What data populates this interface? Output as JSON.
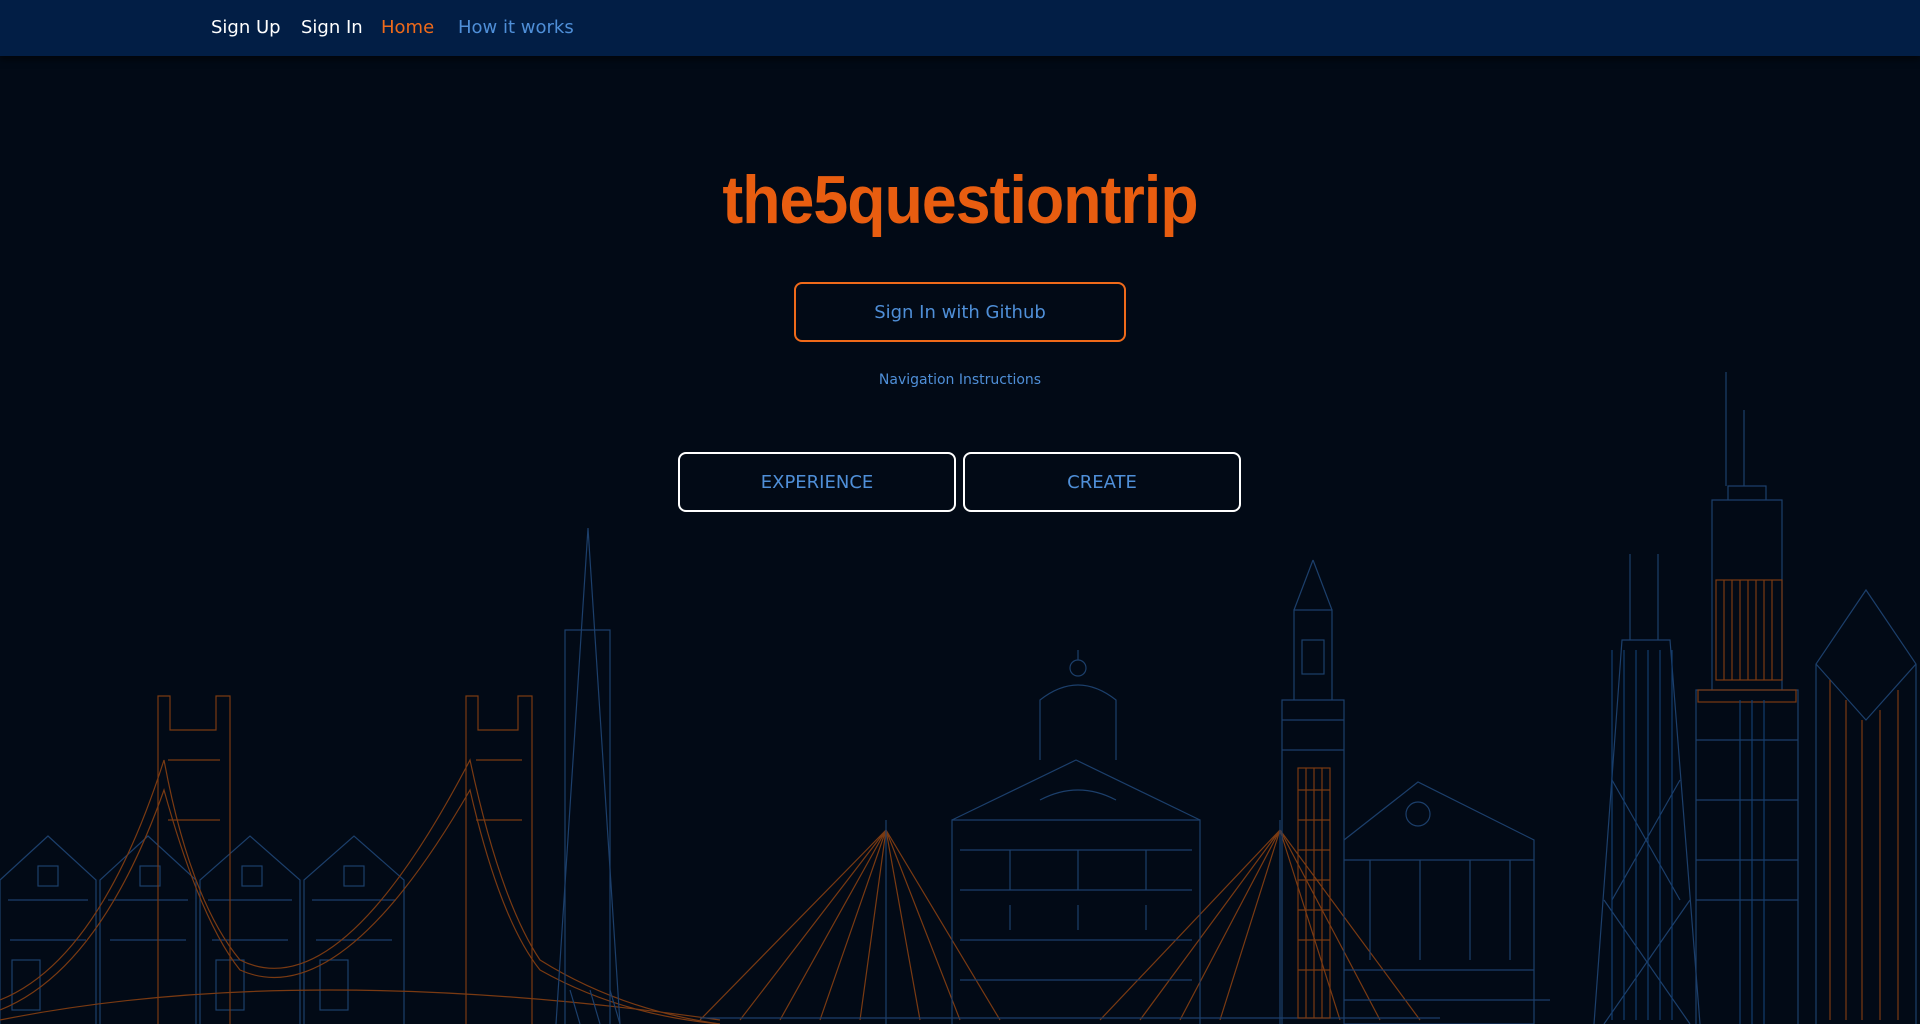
{
  "nav": {
    "items": [
      {
        "label": "Sign Up"
      },
      {
        "label": "Sign In"
      },
      {
        "label": "Home"
      },
      {
        "label": "How it works"
      }
    ]
  },
  "hero": {
    "title": "the5questiontrip",
    "github_button": "Sign In with Github",
    "instructions_link": "Navigation Instructions",
    "experience_button": "EXPERIENCE",
    "create_button": "CREATE"
  },
  "colors": {
    "navbar_bg": "#021e45",
    "page_bg": "#020a16",
    "brand_orange": "#e85d10",
    "link_blue": "#4f8fd8",
    "skyline_blue": "#1c3f6b",
    "skyline_orange": "#7a3a12"
  }
}
